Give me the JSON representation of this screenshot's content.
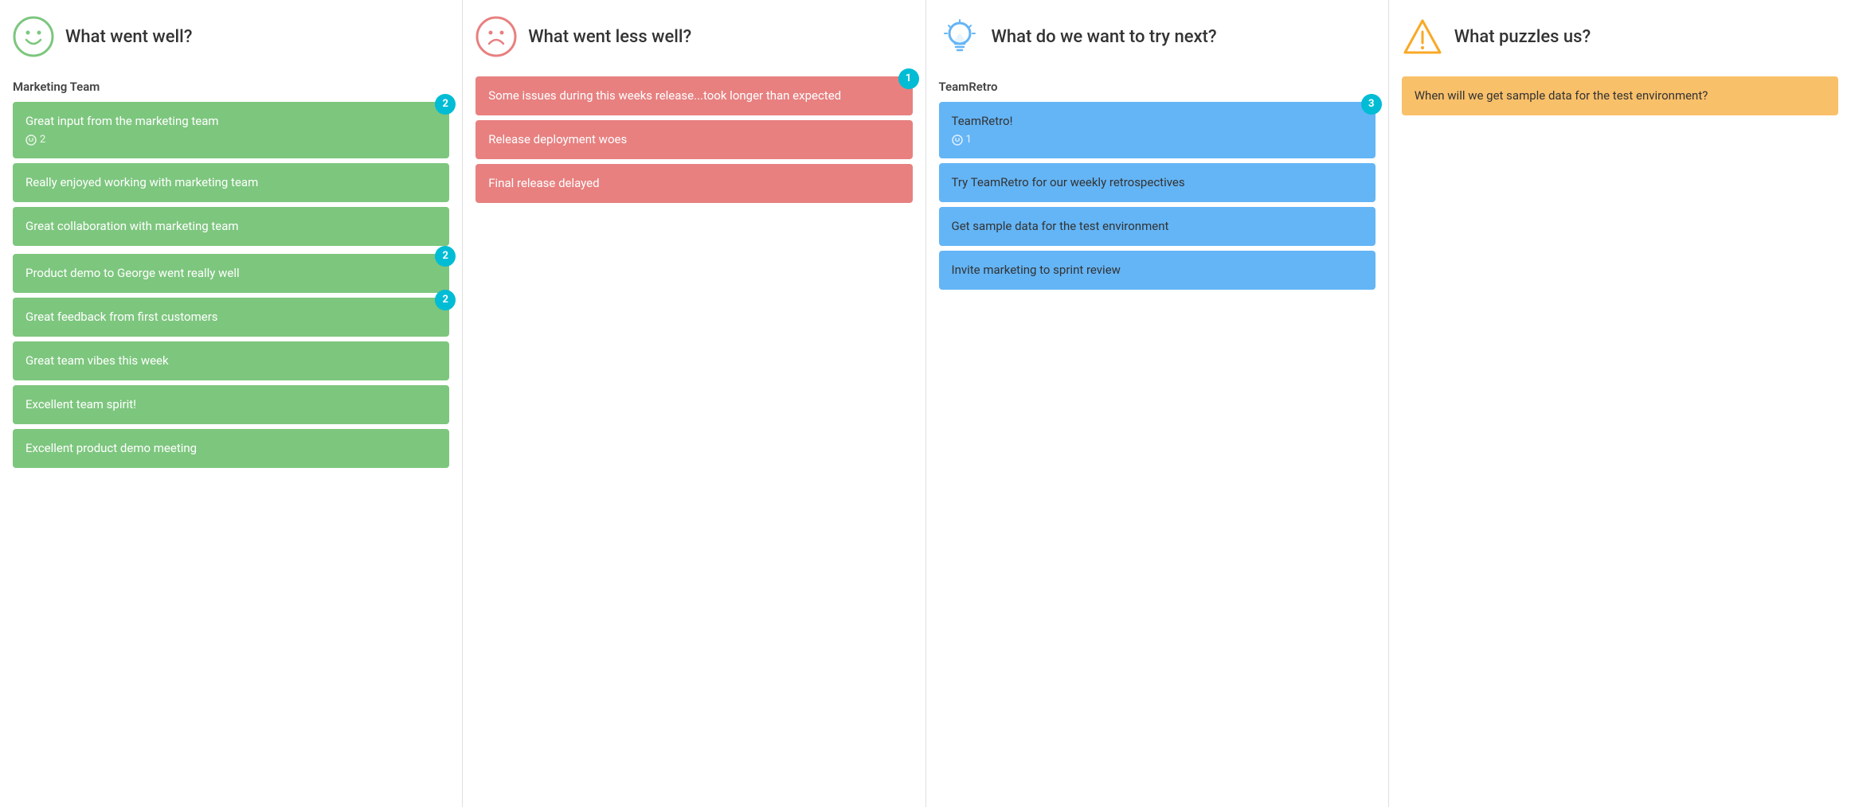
{
  "columns": [
    {
      "id": "went-well",
      "header": {
        "icon": "smile",
        "title": "What went well?"
      },
      "sections": [
        {
          "label": "Marketing Team",
          "cards": [
            {
              "text": "Great input from the marketing team",
              "badge": 2,
              "sub": "2",
              "color": "green"
            },
            {
              "text": "Really enjoyed working with marketing team",
              "badge": null,
              "color": "green"
            },
            {
              "text": "Great collaboration with marketing team",
              "badge": null,
              "color": "green"
            }
          ]
        },
        {
          "label": "",
          "cards": [
            {
              "text": "Product demo to George went really well",
              "badge": 2,
              "color": "green"
            },
            {
              "text": "Great feedback from first customers",
              "badge": 2,
              "color": "green"
            },
            {
              "text": "Great team vibes this week",
              "badge": null,
              "color": "green"
            },
            {
              "text": "Excellent team spirit!",
              "badge": null,
              "color": "green"
            },
            {
              "text": "Excellent product demo meeting",
              "badge": null,
              "color": "green"
            }
          ]
        }
      ]
    },
    {
      "id": "went-less-well",
      "header": {
        "icon": "frown",
        "title": "What went less well?"
      },
      "sections": [
        {
          "label": "",
          "cards": [
            {
              "text": "Some issues during this weeks release...took longer than expected",
              "badge": 1,
              "color": "red"
            },
            {
              "text": "Release deployment woes",
              "badge": null,
              "color": "red"
            },
            {
              "text": "Final release delayed",
              "badge": null,
              "color": "red"
            }
          ]
        }
      ]
    },
    {
      "id": "try-next",
      "header": {
        "icon": "lightbulb",
        "title": "What do we want to try next?"
      },
      "sections": [
        {
          "label": "TeamRetro",
          "cards": [
            {
              "text": "TeamRetro!",
              "badge": 3,
              "sub": "1",
              "color": "blue"
            },
            {
              "text": "Try TeamRetro for our weekly retrospectives",
              "badge": null,
              "color": "blue"
            },
            {
              "text": "Get sample data for the test environment",
              "badge": null,
              "color": "blue"
            },
            {
              "text": "Invite marketing to sprint review",
              "badge": null,
              "color": "blue"
            }
          ]
        }
      ]
    },
    {
      "id": "puzzles-us",
      "header": {
        "icon": "warning",
        "title": "What puzzles us?"
      },
      "sections": [
        {
          "label": "",
          "cards": [
            {
              "text": "When will we get sample data for the test environment?",
              "badge": null,
              "color": "orange"
            }
          ]
        }
      ]
    }
  ]
}
